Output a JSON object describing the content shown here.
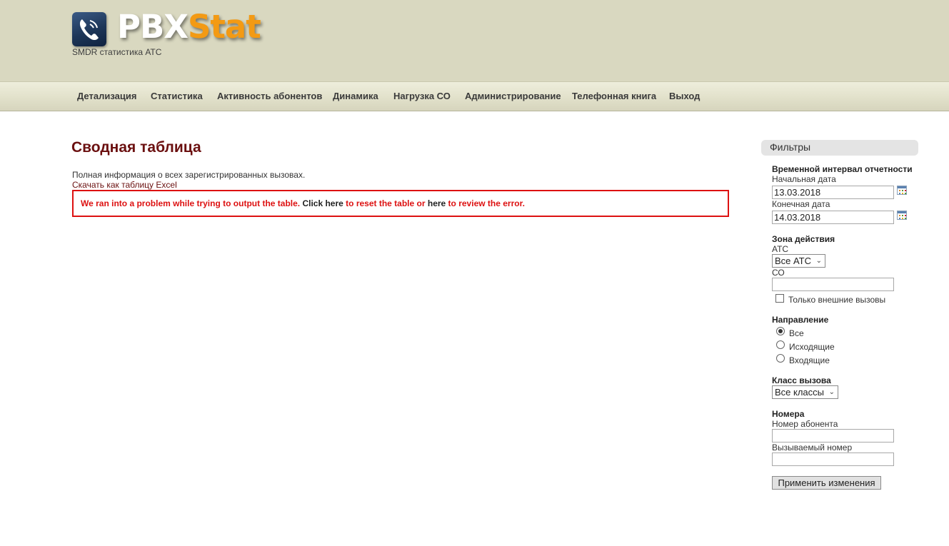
{
  "header": {
    "logo_pbx": "PBX",
    "logo_stat": "Stat",
    "tagline": "SMDR статистика АТС"
  },
  "nav": {
    "items": [
      "Детализация",
      "Статистика",
      "Активность абонентов",
      "Динамика",
      "Нагрузка СО",
      "Администрирование",
      "Телефонная книга",
      "Выход"
    ]
  },
  "main": {
    "title": "Сводная таблица",
    "info": "Полная информация о всех зарегистрированных вызовах.",
    "excel_link": "Скачать как таблицу Excel",
    "error": {
      "part1": "We ran into a problem while trying to output the table. ",
      "link1": "Click here",
      "part2": " to reset the table or ",
      "link2": "here",
      "part3": " to review the error."
    }
  },
  "filters": {
    "heading": "Фильтры",
    "interval": {
      "section": "Временной интервал отчетности",
      "start_label": "Начальная дата",
      "start_value": "13.03.2018",
      "end_label": "Конечная дата",
      "end_value": "14.03.2018"
    },
    "zone": {
      "section": "Зона действия",
      "pbx_label": "АТС",
      "pbx_value": "Все АТС",
      "co_label": "СО",
      "co_value": "",
      "external_only_label": "Только внешние вызовы",
      "external_only_checked": false
    },
    "direction": {
      "section": "Направление",
      "options": [
        "Все",
        "Исходящие",
        "Входящие"
      ],
      "selected": "Все"
    },
    "call_class": {
      "section": "Класс вызова",
      "value": "Все классы"
    },
    "numbers": {
      "section": "Номера",
      "subscriber_label": "Номер абонента",
      "subscriber_value": "",
      "called_label": "Вызываемый номер",
      "called_value": ""
    },
    "apply_label": "Применить изменения"
  },
  "colors": {
    "header_bg": "#d9d8c0",
    "accent_orange": "#f39a14",
    "title_red": "#6b1010",
    "error_red": "#dd1111"
  }
}
